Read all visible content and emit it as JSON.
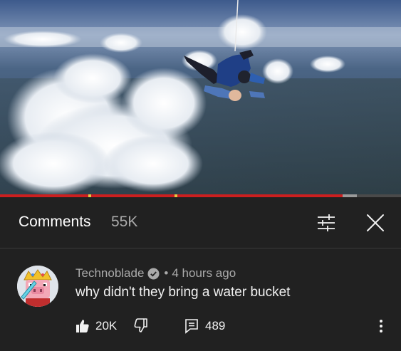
{
  "video": {
    "progress_played": 0.855,
    "progress_buffered": 0.89,
    "chapter_markers": 2
  },
  "comments_panel": {
    "title": "Comments",
    "count": "55K",
    "filter_icon": "sliders-icon",
    "close_icon": "close-icon"
  },
  "comment": {
    "author": "Technoblade",
    "verified_icon": "verified-check-icon",
    "separator": "•",
    "timestamp": "4 hours ago",
    "text": "why didn't they bring a water bucket",
    "likes": "20K",
    "replies": "489",
    "like_icon": "thumbs-up-icon",
    "dislike_icon": "thumbs-down-icon",
    "reply_icon": "reply-icon",
    "more_icon": "more-vertical-icon"
  },
  "colors": {
    "background": "#212121",
    "progress_played": "#cc1f1f",
    "secondary_text": "#aaaaaa"
  }
}
